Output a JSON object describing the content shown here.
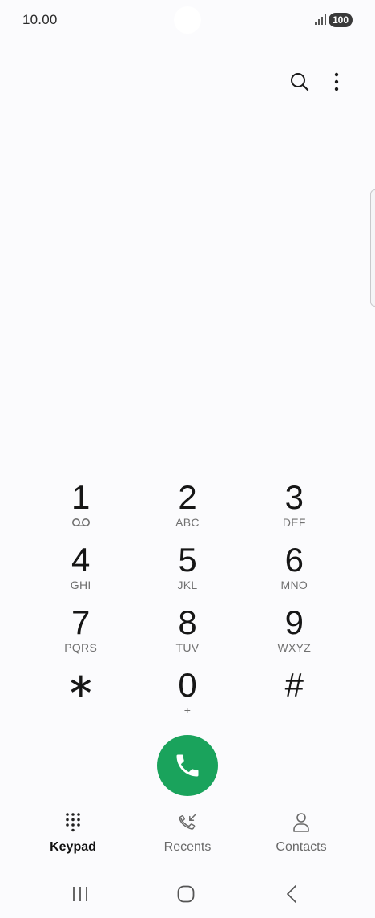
{
  "status_bar": {
    "time": "10.00",
    "battery": "100"
  },
  "icons": {
    "search": "search-icon",
    "more": "more-vertical-icon",
    "voicemail": "voicemail-icon",
    "call": "phone-icon",
    "keypad": "dialpad-icon",
    "recents": "recents-call-icon",
    "contacts": "person-icon"
  },
  "keypad": {
    "keys": [
      {
        "digit": "1",
        "letters": ""
      },
      {
        "digit": "2",
        "letters": "ABC"
      },
      {
        "digit": "3",
        "letters": "DEF"
      },
      {
        "digit": "4",
        "letters": "GHI"
      },
      {
        "digit": "5",
        "letters": "JKL"
      },
      {
        "digit": "6",
        "letters": "MNO"
      },
      {
        "digit": "7",
        "letters": "PQRS"
      },
      {
        "digit": "8",
        "letters": "TUV"
      },
      {
        "digit": "9",
        "letters": "WXYZ"
      },
      {
        "digit": "∗",
        "letters": ""
      },
      {
        "digit": "0",
        "letters": "+"
      },
      {
        "digit": "#",
        "letters": ""
      }
    ]
  },
  "tabs": [
    {
      "label": "Keypad",
      "active": true
    },
    {
      "label": "Recents",
      "active": false
    },
    {
      "label": "Contacts",
      "active": false
    }
  ],
  "colors": {
    "call_button": "#1aa35c",
    "background": "#fbfbfd"
  }
}
